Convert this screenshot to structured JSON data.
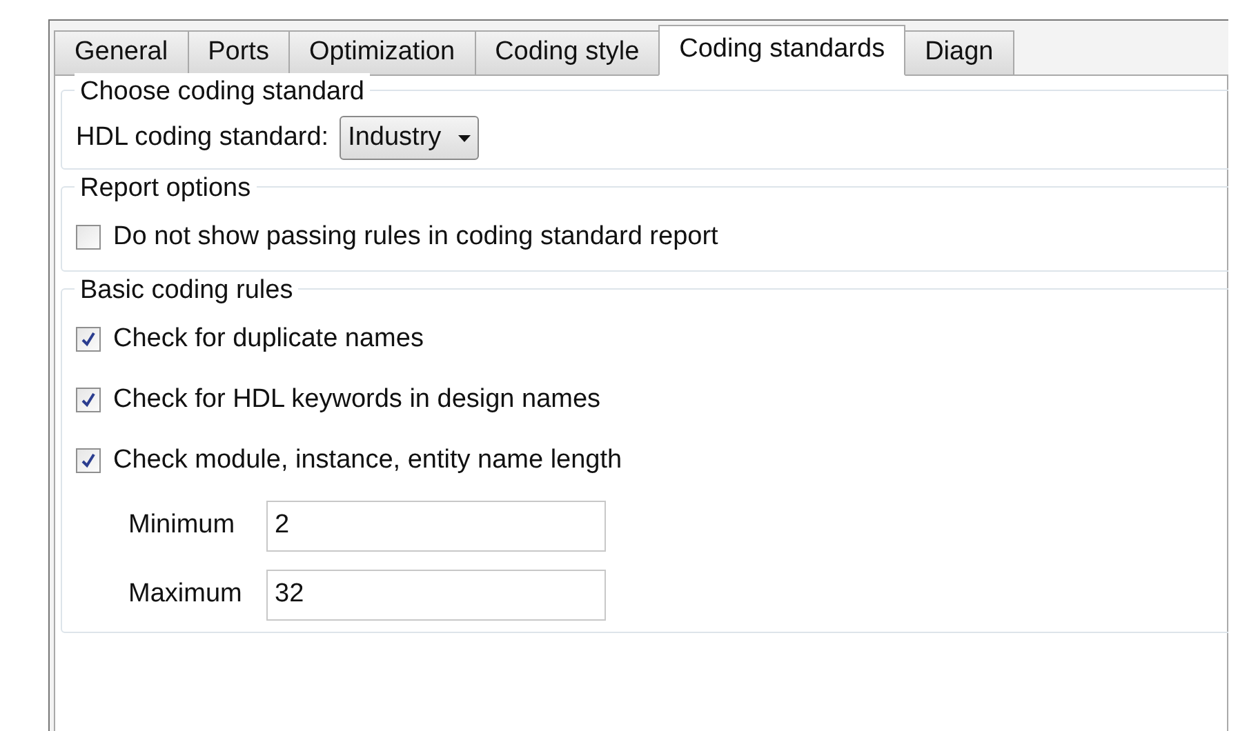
{
  "tabs": [
    {
      "label": "General",
      "selected": false
    },
    {
      "label": "Ports",
      "selected": false
    },
    {
      "label": "Optimization",
      "selected": false
    },
    {
      "label": "Coding style",
      "selected": false
    },
    {
      "label": "Coding standards",
      "selected": true
    },
    {
      "label": "Diagn",
      "selected": false
    }
  ],
  "groups": [
    {
      "title": "Choose coding standard",
      "items": [
        {
          "kind": "dropdown",
          "label": "HDL coding standard:",
          "value": "Industry"
        }
      ]
    },
    {
      "title": "Report options",
      "items": [
        {
          "kind": "checkbox",
          "label": "Do not show passing rules in coding standard report",
          "checked": false
        }
      ]
    },
    {
      "title": "Basic coding rules",
      "items": [
        {
          "kind": "checkbox",
          "label": "Check for duplicate names",
          "checked": true
        },
        {
          "kind": "checkbox",
          "label": "Check for HDL keywords in design names",
          "checked": true
        },
        {
          "kind": "checkbox",
          "label": "Check module, instance, entity name length",
          "checked": true
        },
        {
          "kind": "field",
          "label": "Minimum",
          "value": "2"
        },
        {
          "kind": "field",
          "label": "Maximum",
          "value": "32"
        }
      ]
    }
  ]
}
